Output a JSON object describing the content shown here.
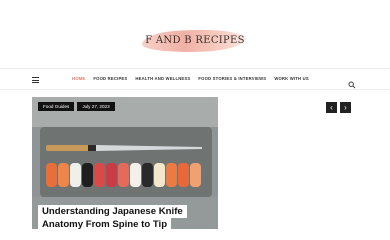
{
  "site": {
    "logo_text": "F AND B RECIPES"
  },
  "nav": {
    "items": [
      {
        "label": "HOME",
        "active": true
      },
      {
        "label": "FOOD RECIPES",
        "active": false
      },
      {
        "label": "HEALTH AND WELLNESS",
        "active": false
      },
      {
        "label": "FOOD STORIES & INTERVIEWS",
        "active": false
      },
      {
        "label": "WORK WITH US",
        "active": false
      }
    ],
    "icons": {
      "menu": "hamburger-icon",
      "search": "search-icon"
    }
  },
  "featured": {
    "category": "Food Guides",
    "date": "July 27, 2023",
    "title_line1": "Understanding Japanese Knife",
    "title_line2": "Anatomy From Spine to Tip"
  },
  "slider": {
    "prev_icon": "chevron-left-icon",
    "next_icon": "chevron-right-icon"
  },
  "colors": {
    "accent": "#e07a6a",
    "dark": "#111111"
  }
}
